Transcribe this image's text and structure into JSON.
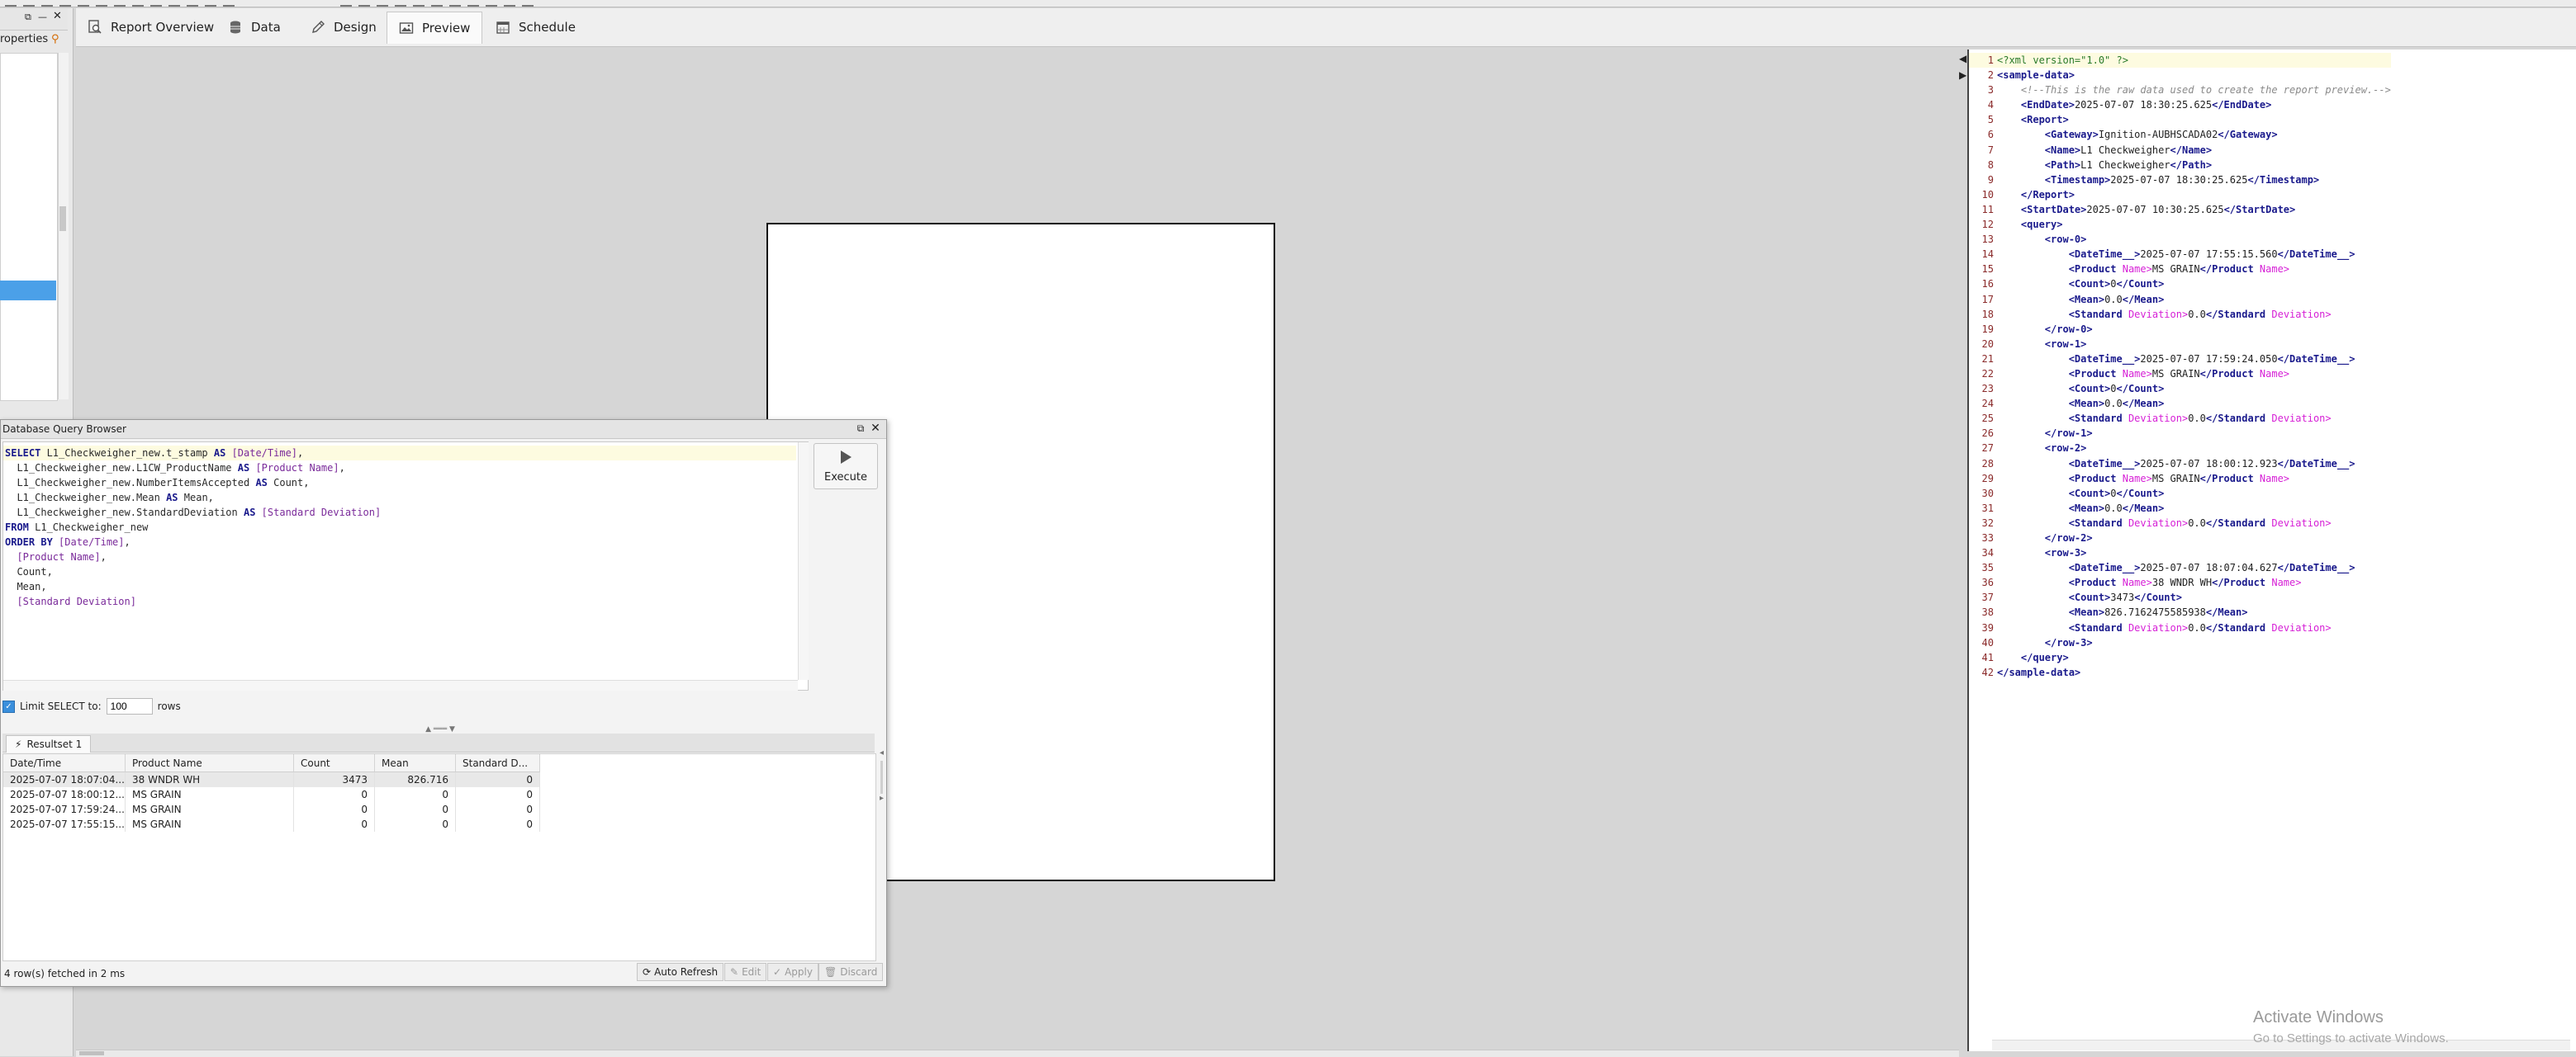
{
  "tabs": [
    {
      "label": "Report Overview",
      "icon": "magnifier-report-icon"
    },
    {
      "label": "Data",
      "icon": "database-icon"
    },
    {
      "label": "Design",
      "icon": "pencil-icon"
    },
    {
      "label": "Preview",
      "icon": "image-icon"
    },
    {
      "label": "Schedule",
      "icon": "calendar-icon"
    }
  ],
  "active_tab": "Preview",
  "properties": {
    "title": "roperties"
  },
  "dialog": {
    "title": "Database Query Browser",
    "execute_label": "Execute",
    "sql_lines": [
      [
        {
          "k": "kw",
          "t": "SELECT "
        },
        {
          "k": "id",
          "t": "L1_Checkweigher_new.t_stamp "
        },
        {
          "k": "kw",
          "t": "AS "
        },
        {
          "k": "al",
          "t": "[Date/Time]"
        },
        {
          "k": "id",
          "t": ","
        }
      ],
      [
        {
          "k": "id",
          "t": "  L1_Checkweigher_new.L1CW_ProductName "
        },
        {
          "k": "kw",
          "t": "AS "
        },
        {
          "k": "al",
          "t": "[Product Name]"
        },
        {
          "k": "id",
          "t": ","
        }
      ],
      [
        {
          "k": "id",
          "t": "  L1_Checkweigher_new.NumberItemsAccepted "
        },
        {
          "k": "kw",
          "t": "AS "
        },
        {
          "k": "id",
          "t": "Count,"
        }
      ],
      [
        {
          "k": "id",
          "t": "  L1_Checkweigher_new.Mean "
        },
        {
          "k": "kw",
          "t": "AS "
        },
        {
          "k": "id",
          "t": "Mean,"
        }
      ],
      [
        {
          "k": "id",
          "t": "  L1_Checkweigher_new.StandardDeviation "
        },
        {
          "k": "kw",
          "t": "AS "
        },
        {
          "k": "al",
          "t": "[Standard Deviation]"
        }
      ],
      [
        {
          "k": "kw",
          "t": "FROM "
        },
        {
          "k": "id",
          "t": "L1_Checkweigher_new"
        }
      ],
      [
        {
          "k": "kw",
          "t": "ORDER BY "
        },
        {
          "k": "al",
          "t": "[Date/Time]"
        },
        {
          "k": "id",
          "t": ","
        }
      ],
      [
        {
          "k": "al",
          "t": "  [Product Name]"
        },
        {
          "k": "id",
          "t": ","
        }
      ],
      [
        {
          "k": "id",
          "t": "  Count,"
        }
      ],
      [
        {
          "k": "id",
          "t": "  Mean,"
        }
      ],
      [
        {
          "k": "al",
          "t": "  [Standard Deviation]"
        }
      ]
    ],
    "limit_label": "Limit SELECT to:",
    "limit_value": "100",
    "limit_unit": "rows",
    "results_tab": "Resultset 1",
    "columns": [
      "Date/Time",
      "Product Name",
      "Count",
      "Mean",
      "Standard D..."
    ],
    "rows": [
      [
        "2025-07-07 18:07:04....",
        "38 WNDR WH",
        "3473",
        "826.716",
        "0"
      ],
      [
        "2025-07-07 18:00:12....",
        "MS GRAIN",
        "0",
        "0",
        "0"
      ],
      [
        "2025-07-07 17:59:24....",
        "MS GRAIN",
        "0",
        "0",
        "0"
      ],
      [
        "2025-07-07 17:55:15....",
        "MS GRAIN",
        "0",
        "0",
        "0"
      ]
    ],
    "status": "4 row(s) fetched in 2 ms",
    "buttons": {
      "auto_refresh": "Auto Refresh",
      "edit": "Edit",
      "apply": "Apply",
      "discard": "Discard"
    }
  },
  "xml_lines": [
    [
      {
        "k": "pi",
        "t": "<?xml version=\"1.0\" ?>"
      }
    ],
    [
      {
        "k": "t",
        "t": "<sample-data>"
      }
    ],
    [
      {
        "k": "s",
        "t": "    "
      },
      {
        "k": "c",
        "t": "<!--This is the raw data used to create the report preview.-->"
      }
    ],
    [
      {
        "k": "s",
        "t": "    "
      },
      {
        "k": "t",
        "t": "<EndDate>"
      },
      {
        "k": "v",
        "t": "2025-07-07 18:30:25.625"
      },
      {
        "k": "t",
        "t": "</EndDate>"
      }
    ],
    [
      {
        "k": "s",
        "t": "    "
      },
      {
        "k": "t",
        "t": "<Report>"
      }
    ],
    [
      {
        "k": "s",
        "t": "        "
      },
      {
        "k": "t",
        "t": "<Gateway>"
      },
      {
        "k": "v",
        "t": "Ignition-AUBHSCADA02"
      },
      {
        "k": "t",
        "t": "</Gateway>"
      }
    ],
    [
      {
        "k": "s",
        "t": "        "
      },
      {
        "k": "t",
        "t": "<Name>"
      },
      {
        "k": "v",
        "t": "L1 Checkweigher"
      },
      {
        "k": "t",
        "t": "</Name>"
      }
    ],
    [
      {
        "k": "s",
        "t": "        "
      },
      {
        "k": "t",
        "t": "<Path>"
      },
      {
        "k": "v",
        "t": "L1 Checkweigher"
      },
      {
        "k": "t",
        "t": "</Path>"
      }
    ],
    [
      {
        "k": "s",
        "t": "        "
      },
      {
        "k": "t",
        "t": "<Timestamp>"
      },
      {
        "k": "v",
        "t": "2025-07-07 18:30:25.625"
      },
      {
        "k": "t",
        "t": "</Timestamp>"
      }
    ],
    [
      {
        "k": "s",
        "t": "    "
      },
      {
        "k": "t",
        "t": "</Report>"
      }
    ],
    [
      {
        "k": "s",
        "t": "    "
      },
      {
        "k": "t",
        "t": "<StartDate>"
      },
      {
        "k": "v",
        "t": "2025-07-07 10:30:25.625"
      },
      {
        "k": "t",
        "t": "</StartDate>"
      }
    ],
    [
      {
        "k": "s",
        "t": "    "
      },
      {
        "k": "t",
        "t": "<query>"
      }
    ],
    [
      {
        "k": "s",
        "t": "        "
      },
      {
        "k": "t",
        "t": "<row-0>"
      }
    ],
    [
      {
        "k": "s",
        "t": "            "
      },
      {
        "k": "t",
        "t": "<DateTime__>"
      },
      {
        "k": "v",
        "t": "2025-07-07 17:55:15.560"
      },
      {
        "k": "t",
        "t": "</DateTime__>"
      }
    ],
    [
      {
        "k": "s",
        "t": "            "
      },
      {
        "k": "t",
        "t": "<Product "
      },
      {
        "k": "a",
        "t": "Name>"
      },
      {
        "k": "v",
        "t": "MS GRAIN"
      },
      {
        "k": "t",
        "t": "</Product "
      },
      {
        "k": "a",
        "t": "Name>"
      }
    ],
    [
      {
        "k": "s",
        "t": "            "
      },
      {
        "k": "t",
        "t": "<Count>"
      },
      {
        "k": "v",
        "t": "0"
      },
      {
        "k": "t",
        "t": "</Count>"
      }
    ],
    [
      {
        "k": "s",
        "t": "            "
      },
      {
        "k": "t",
        "t": "<Mean>"
      },
      {
        "k": "v",
        "t": "0.0"
      },
      {
        "k": "t",
        "t": "</Mean>"
      }
    ],
    [
      {
        "k": "s",
        "t": "            "
      },
      {
        "k": "t",
        "t": "<Standard "
      },
      {
        "k": "a",
        "t": "Deviation>"
      },
      {
        "k": "v",
        "t": "0.0"
      },
      {
        "k": "t",
        "t": "</Standard "
      },
      {
        "k": "a",
        "t": "Deviation>"
      }
    ],
    [
      {
        "k": "s",
        "t": "        "
      },
      {
        "k": "t",
        "t": "</row-0>"
      }
    ],
    [
      {
        "k": "s",
        "t": "        "
      },
      {
        "k": "t",
        "t": "<row-1>"
      }
    ],
    [
      {
        "k": "s",
        "t": "            "
      },
      {
        "k": "t",
        "t": "<DateTime__>"
      },
      {
        "k": "v",
        "t": "2025-07-07 17:59:24.050"
      },
      {
        "k": "t",
        "t": "</DateTime__>"
      }
    ],
    [
      {
        "k": "s",
        "t": "            "
      },
      {
        "k": "t",
        "t": "<Product "
      },
      {
        "k": "a",
        "t": "Name>"
      },
      {
        "k": "v",
        "t": "MS GRAIN"
      },
      {
        "k": "t",
        "t": "</Product "
      },
      {
        "k": "a",
        "t": "Name>"
      }
    ],
    [
      {
        "k": "s",
        "t": "            "
      },
      {
        "k": "t",
        "t": "<Count>"
      },
      {
        "k": "v",
        "t": "0"
      },
      {
        "k": "t",
        "t": "</Count>"
      }
    ],
    [
      {
        "k": "s",
        "t": "            "
      },
      {
        "k": "t",
        "t": "<Mean>"
      },
      {
        "k": "v",
        "t": "0.0"
      },
      {
        "k": "t",
        "t": "</Mean>"
      }
    ],
    [
      {
        "k": "s",
        "t": "            "
      },
      {
        "k": "t",
        "t": "<Standard "
      },
      {
        "k": "a",
        "t": "Deviation>"
      },
      {
        "k": "v",
        "t": "0.0"
      },
      {
        "k": "t",
        "t": "</Standard "
      },
      {
        "k": "a",
        "t": "Deviation>"
      }
    ],
    [
      {
        "k": "s",
        "t": "        "
      },
      {
        "k": "t",
        "t": "</row-1>"
      }
    ],
    [
      {
        "k": "s",
        "t": "        "
      },
      {
        "k": "t",
        "t": "<row-2>"
      }
    ],
    [
      {
        "k": "s",
        "t": "            "
      },
      {
        "k": "t",
        "t": "<DateTime__>"
      },
      {
        "k": "v",
        "t": "2025-07-07 18:00:12.923"
      },
      {
        "k": "t",
        "t": "</DateTime__>"
      }
    ],
    [
      {
        "k": "s",
        "t": "            "
      },
      {
        "k": "t",
        "t": "<Product "
      },
      {
        "k": "a",
        "t": "Name>"
      },
      {
        "k": "v",
        "t": "MS GRAIN"
      },
      {
        "k": "t",
        "t": "</Product "
      },
      {
        "k": "a",
        "t": "Name>"
      }
    ],
    [
      {
        "k": "s",
        "t": "            "
      },
      {
        "k": "t",
        "t": "<Count>"
      },
      {
        "k": "v",
        "t": "0"
      },
      {
        "k": "t",
        "t": "</Count>"
      }
    ],
    [
      {
        "k": "s",
        "t": "            "
      },
      {
        "k": "t",
        "t": "<Mean>"
      },
      {
        "k": "v",
        "t": "0.0"
      },
      {
        "k": "t",
        "t": "</Mean>"
      }
    ],
    [
      {
        "k": "s",
        "t": "            "
      },
      {
        "k": "t",
        "t": "<Standard "
      },
      {
        "k": "a",
        "t": "Deviation>"
      },
      {
        "k": "v",
        "t": "0.0"
      },
      {
        "k": "t",
        "t": "</Standard "
      },
      {
        "k": "a",
        "t": "Deviation>"
      }
    ],
    [
      {
        "k": "s",
        "t": "        "
      },
      {
        "k": "t",
        "t": "</row-2>"
      }
    ],
    [
      {
        "k": "s",
        "t": "        "
      },
      {
        "k": "t",
        "t": "<row-3>"
      }
    ],
    [
      {
        "k": "s",
        "t": "            "
      },
      {
        "k": "t",
        "t": "<DateTime__>"
      },
      {
        "k": "v",
        "t": "2025-07-07 18:07:04.627"
      },
      {
        "k": "t",
        "t": "</DateTime__>"
      }
    ],
    [
      {
        "k": "s",
        "t": "            "
      },
      {
        "k": "t",
        "t": "<Product "
      },
      {
        "k": "a",
        "t": "Name>"
      },
      {
        "k": "v",
        "t": "38 WNDR WH"
      },
      {
        "k": "t",
        "t": "</Product "
      },
      {
        "k": "a",
        "t": "Name>"
      }
    ],
    [
      {
        "k": "s",
        "t": "            "
      },
      {
        "k": "t",
        "t": "<Count>"
      },
      {
        "k": "v",
        "t": "3473"
      },
      {
        "k": "t",
        "t": "</Count>"
      }
    ],
    [
      {
        "k": "s",
        "t": "            "
      },
      {
        "k": "t",
        "t": "<Mean>"
      },
      {
        "k": "v",
        "t": "826.7162475585938"
      },
      {
        "k": "t",
        "t": "</Mean>"
      }
    ],
    [
      {
        "k": "s",
        "t": "            "
      },
      {
        "k": "t",
        "t": "<Standard "
      },
      {
        "k": "a",
        "t": "Deviation>"
      },
      {
        "k": "v",
        "t": "0.0"
      },
      {
        "k": "t",
        "t": "</Standard "
      },
      {
        "k": "a",
        "t": "Deviation>"
      }
    ],
    [
      {
        "k": "s",
        "t": "        "
      },
      {
        "k": "t",
        "t": "</row-3>"
      }
    ],
    [
      {
        "k": "s",
        "t": "    "
      },
      {
        "k": "t",
        "t": "</query>"
      }
    ],
    [
      {
        "k": "t",
        "t": "</sample-data>"
      }
    ]
  ],
  "activate_windows": {
    "title": "Activate Windows",
    "subtitle": "Go to Settings to activate Windows."
  }
}
